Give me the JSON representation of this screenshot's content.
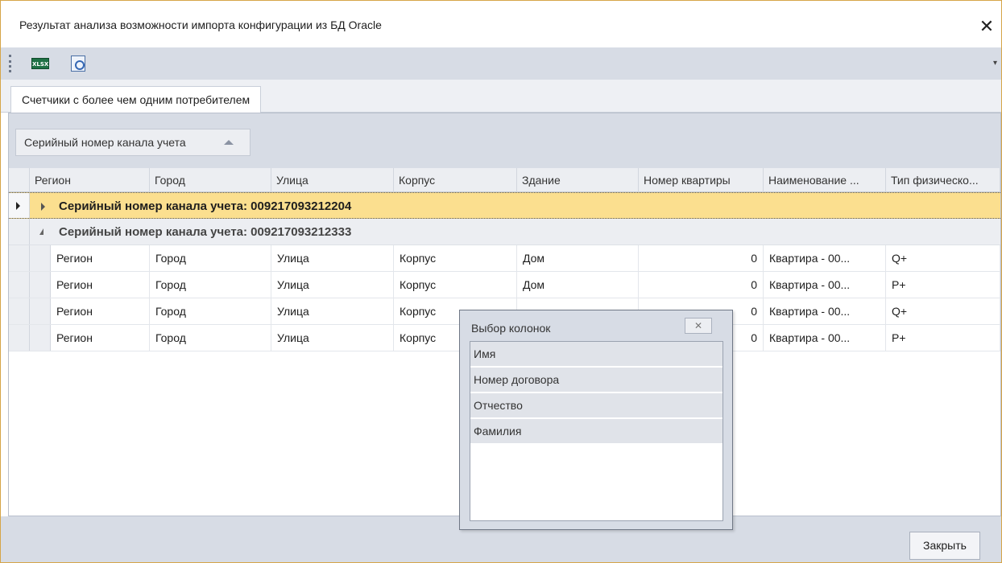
{
  "window": {
    "title": "Результат анализа возможности импорта конфигурации из БД Oracle",
    "close_glyph": "✕"
  },
  "toolbar": {
    "buttons": [
      {
        "icon": "xlsx-export-icon",
        "label": "XLSX"
      },
      {
        "icon": "print-preview-icon"
      }
    ]
  },
  "tabs": [
    {
      "label": "Счетчики с более чем одним потребителем",
      "active": true
    }
  ],
  "group_panel": {
    "chip_label": "Серийный номер канала учета",
    "sort": "ascending"
  },
  "grid": {
    "columns": [
      "Регион",
      "Город",
      "Улица",
      "Корпус",
      "Здание",
      "Номер квартиры",
      "Наименование ...",
      "Тип физическо..."
    ],
    "groups": [
      {
        "label": "Серийный номер канала учета: 009217093212204",
        "expanded": false,
        "focused": true
      },
      {
        "label": "Серийный номер канала учета: 009217093212333",
        "expanded": true,
        "focused": false
      }
    ],
    "rows": [
      [
        "Регион",
        "Город",
        "Улица",
        "Корпус",
        "Дом",
        "0",
        "Квартира - 00...",
        "Q+"
      ],
      [
        "Регион",
        "Город",
        "Улица",
        "Корпус",
        "Дом",
        "0",
        "Квартира - 00...",
        "P+"
      ],
      [
        "Регион",
        "Город",
        "Улица",
        "Корпус",
        "",
        "0",
        "Квартира - 00...",
        "Q+"
      ],
      [
        "Регион",
        "Город",
        "Улица",
        "Корпус",
        "",
        "0",
        "Квартира - 00...",
        "P+"
      ]
    ]
  },
  "column_chooser": {
    "title": "Выбор колонок",
    "close_glyph": "✕",
    "items": [
      "Имя",
      "Номер договора",
      "Отчество",
      "Фамилия"
    ]
  },
  "footer": {
    "close_label": "Закрыть"
  },
  "colors": {
    "accent_border": "#d6a548",
    "panel_bg": "#d7dce5",
    "focused_group": "#fbdf8f"
  }
}
